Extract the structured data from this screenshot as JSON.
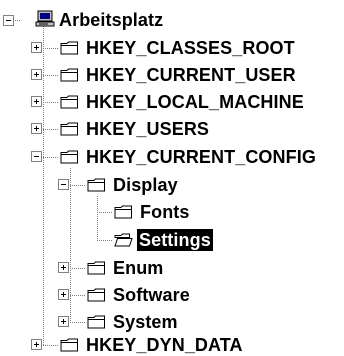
{
  "tree": {
    "root": {
      "label": "Arbeitsplatz",
      "icon": "computer-icon",
      "state": "expanded"
    },
    "items": [
      {
        "label": "HKEY_CLASSES_ROOT",
        "state": "collapsed",
        "icon": "folder-icon"
      },
      {
        "label": "HKEY_CURRENT_USER",
        "state": "collapsed",
        "icon": "folder-icon"
      },
      {
        "label": "HKEY_LOCAL_MACHINE",
        "state": "collapsed",
        "icon": "folder-icon"
      },
      {
        "label": "HKEY_USERS",
        "state": "collapsed",
        "icon": "folder-icon"
      },
      {
        "label": "HKEY_CURRENT_CONFIG",
        "state": "expanded",
        "icon": "folder-icon",
        "children": [
          {
            "label": "Display",
            "state": "expanded",
            "icon": "folder-icon",
            "children": [
              {
                "label": "Fonts",
                "icon": "folder-icon",
                "selected": false
              },
              {
                "label": "Settings",
                "icon": "open-folder-icon",
                "selected": true
              }
            ]
          },
          {
            "label": "Enum",
            "state": "collapsed",
            "icon": "folder-icon"
          },
          {
            "label": "Software",
            "state": "collapsed",
            "icon": "folder-icon"
          },
          {
            "label": "System",
            "state": "collapsed",
            "icon": "folder-icon"
          }
        ]
      },
      {
        "label": "HKEY_DYN_DATA",
        "state": "collapsed",
        "icon": "folder-icon"
      }
    ]
  },
  "colors": {
    "selection_bg": "#000000",
    "selection_fg": "#ffffff",
    "lines": "#7f7f7f"
  }
}
